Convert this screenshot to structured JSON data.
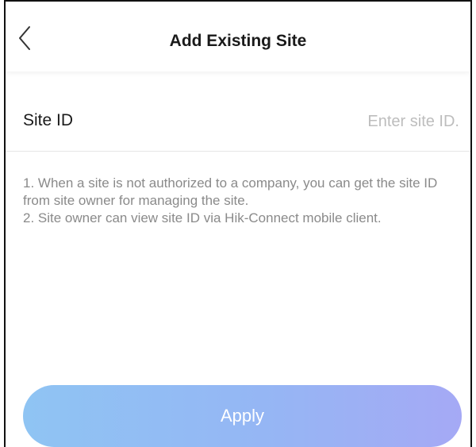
{
  "header": {
    "back_icon": "chevron-left-icon",
    "title": "Add Existing Site"
  },
  "site_id_row": {
    "label": "Site ID",
    "value": "",
    "placeholder": "Enter site ID."
  },
  "notes": [
    "1. When a site is not authorized to a company, you can get the site ID from site owner for managing the site.",
    "2. Site owner can view site ID via Hik-Connect mobile client."
  ],
  "actions": {
    "apply_label": "Apply"
  },
  "colors": {
    "title_text": "#1a1a1a",
    "placeholder": "#bdbdbd",
    "note_text": "#8a8a8a",
    "divider": "#e6e6e6",
    "button_gradient_start": "#8fc4f3",
    "button_gradient_end": "#a5a9f5",
    "button_text": "#ffffff"
  }
}
